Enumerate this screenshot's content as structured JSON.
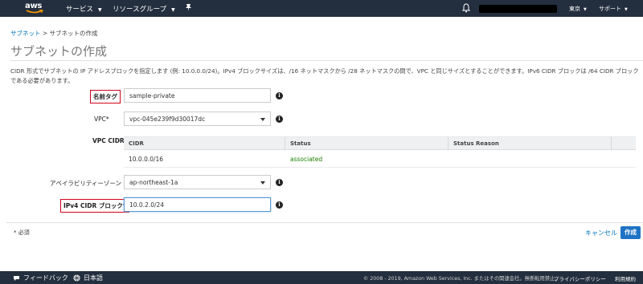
{
  "topnav": {
    "logo_text": "aws",
    "services": "サービス",
    "resource_groups": "リソースグループ",
    "region": "東京",
    "support": "サポート",
    "pin_icon": "pin-icon",
    "bell_icon": "bell-icon"
  },
  "breadcrumb": {
    "link": "サブネット",
    "separator": " > ",
    "current": "サブネットの作成"
  },
  "page": {
    "title": "サブネットの作成",
    "description": "CIDR 形式でサブネットの IP アドレスブロックを指定します (例: 10.0.0.0/24)。IPv4 ブロックサイズは、/16 ネットマスクから /28 ネットマスクの間で、VPC と同じサイズとすることができます。IPv6 CIDR ブロックは /64 CIDR ブロックである必要があります。"
  },
  "form": {
    "name_tag": {
      "label": "名前タグ",
      "value": "sample-private"
    },
    "vpc": {
      "label": "VPC*",
      "value": "vpc-045e239f9d30017dc"
    },
    "vpc_cidr": {
      "label": "VPC CIDR",
      "columns": [
        "CIDR",
        "Status",
        "Status Reason"
      ],
      "rows": [
        {
          "cidr": "10.0.0.0/16",
          "status": "associated",
          "reason": ""
        }
      ]
    },
    "availability_zone": {
      "label": "アベイラビリティーゾーン",
      "value": "ap-northeast-1a"
    },
    "ipv4_cidr": {
      "label": "IPv4 CIDR ブロック*",
      "value": "10.0.2.0/24"
    }
  },
  "actions": {
    "required_note": "* 必須",
    "cancel": "キャンセル",
    "create": "作成"
  },
  "footer": {
    "feedback": "フィードバック",
    "language": "日本語",
    "copyright": "© 2008 - 2019, Amazon Web Services, Inc. またはその関連会社。無断転用禁止。",
    "privacy": "プライバシーポリシー",
    "terms": "利用規約"
  },
  "colors": {
    "nav_bg": "#232f3e",
    "link": "#0073bb",
    "primary_button": "#1f72c4",
    "status_ok": "#1d8102",
    "highlight_box": "#d0021b"
  }
}
